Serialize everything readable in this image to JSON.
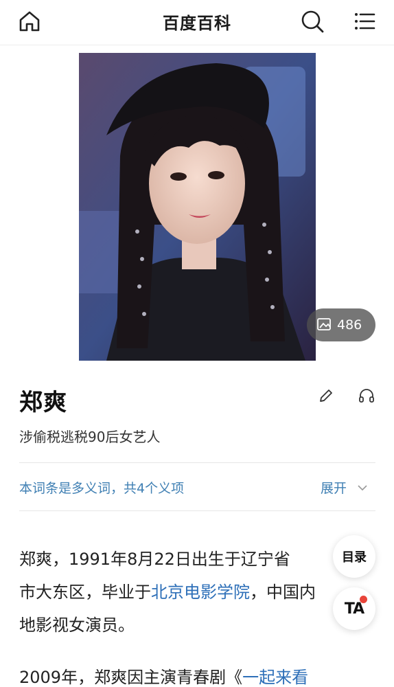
{
  "header": {
    "title": "百度百科"
  },
  "gallery": {
    "count": "486"
  },
  "entry": {
    "name": "郑爽",
    "description": "涉偷税逃税90后女艺人",
    "polysemy_text": "本词条是多义词，共4个义项",
    "expand_label": "展开"
  },
  "body": {
    "p1_a": "郑爽，1991年8月22日出生于辽宁省",
    "p1_b": "市大东区，毕业于",
    "p1_link": "北京电影学院",
    "p1_c": "，中国内",
    "p1_d": "地影视女演员。",
    "p2_a": "2009年，郑爽因主演青春剧《",
    "p2_link": "一起来看"
  },
  "floating": {
    "toc_label": "目录",
    "ta_label": "TA"
  },
  "colors": {
    "link": "#2d6fb8",
    "polysemy": "#3f7fb3",
    "badge_dot": "#e8443a"
  },
  "icons": [
    "home-icon",
    "search-icon",
    "menu-icon",
    "gallery-icon",
    "edit-icon",
    "headphones-icon",
    "chevron-down-icon"
  ]
}
